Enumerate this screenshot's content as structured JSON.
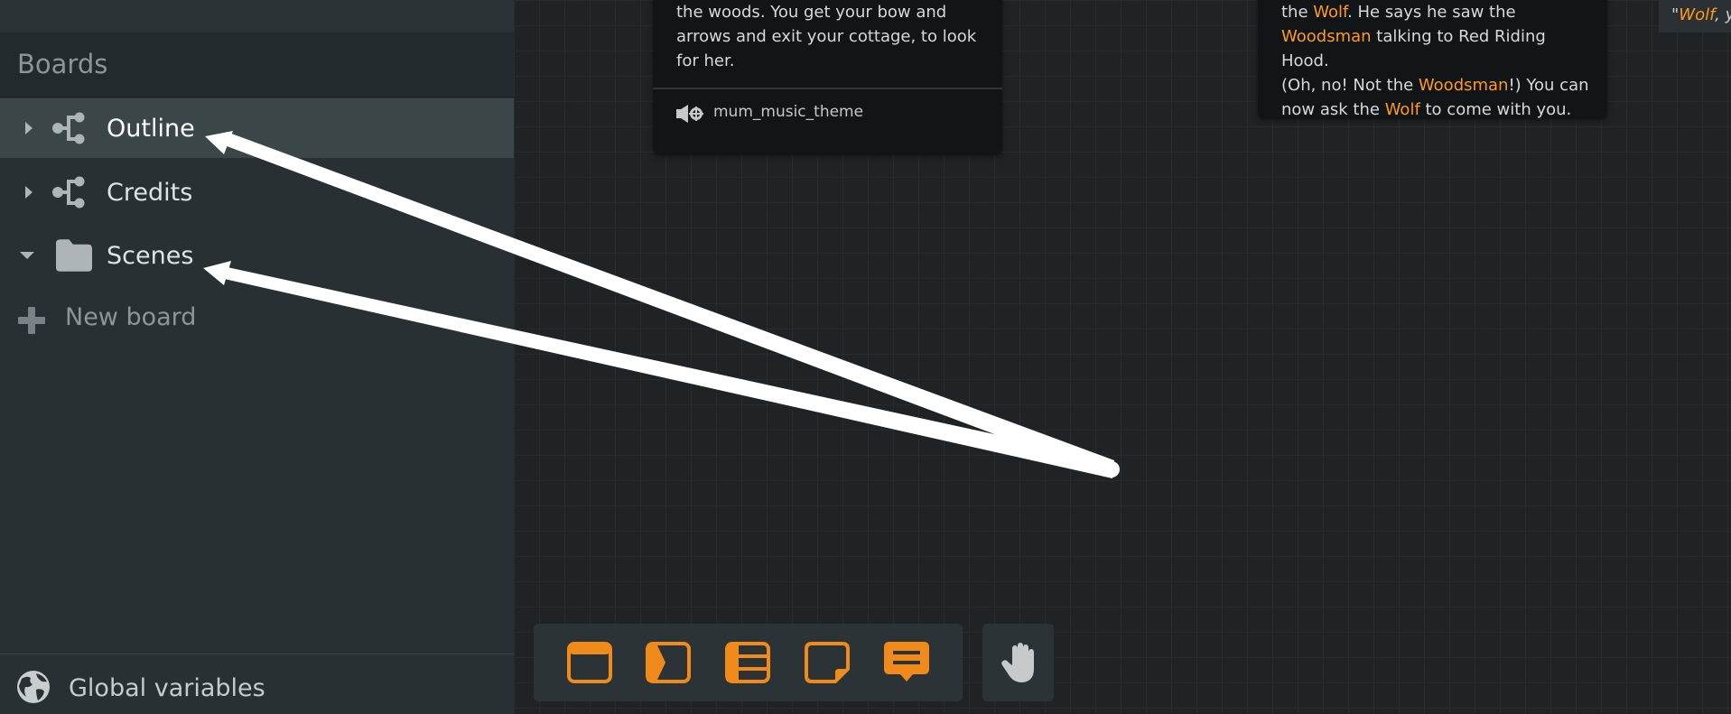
{
  "sidebar": {
    "header": "Boards",
    "items": [
      {
        "label": "Outline",
        "icon": "outline-branch-icon",
        "expanded": false,
        "selected": true
      },
      {
        "label": "Credits",
        "icon": "outline-branch-icon",
        "expanded": false,
        "selected": false
      },
      {
        "label": "Scenes",
        "icon": "folder-icon",
        "expanded": true,
        "selected": false
      }
    ],
    "new_board": "New board",
    "global_variables": "Global variables"
  },
  "canvas": {
    "node1": {
      "lines": [
        "the woods. You get your bow and",
        "arrows and exit your cottage, to look",
        "for her."
      ],
      "audio": "mum_music_theme"
    },
    "node2": {
      "l1a": "the ",
      "l1b": "Wolf",
      "l1c": ". He says he saw the",
      "l2a": "Woodsman",
      "l2b": " talking to Red Riding Hood.",
      "l3a": "(Oh, no! Not the ",
      "l3b": "Woodsman",
      "l3c": "!) You can",
      "l4a": "now ask the ",
      "l4b": "Wolf",
      "l4c": " to come with you."
    },
    "topright": {
      "q": "\"",
      "hl": "Wolf",
      "rest": ", yo"
    }
  },
  "toolbar": {
    "tools": [
      "frame-node-icon",
      "flow-node-icon",
      "list-node-icon",
      "note-node-icon",
      "comment-node-icon"
    ],
    "hand": "hand-icon"
  },
  "colors": {
    "accent": "#ff9a1f",
    "sidebar": "#283034",
    "canvas": "#1f2326"
  }
}
